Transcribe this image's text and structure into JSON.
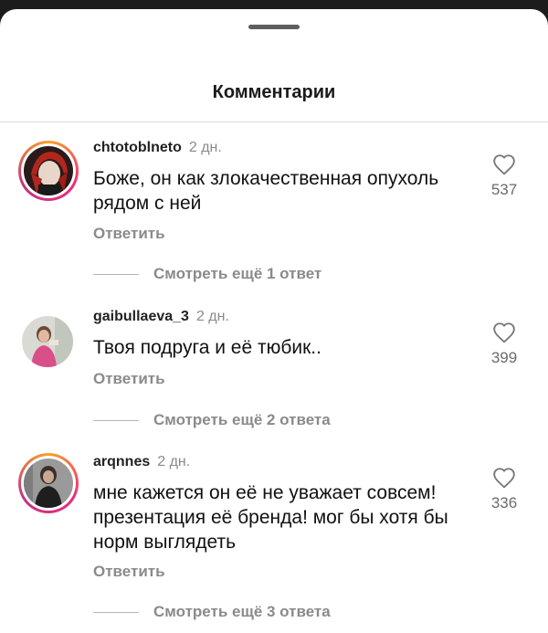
{
  "header": {
    "title": "Комментарии"
  },
  "comments": [
    {
      "username": "chtotoblneto",
      "time": "2 дн.",
      "text": "Боже, он как злокачественная опухоль рядом с ней",
      "reply_label": "Ответить",
      "likes": "537",
      "view_replies": "Смотреть ещё 1 ответ",
      "avatar_story_ring": true
    },
    {
      "username": "gaibullaeva_3",
      "time": "2 дн.",
      "text": "Твоя подруга и её тюбик..",
      "reply_label": "Ответить",
      "likes": "399",
      "view_replies": "Смотреть ещё 2 ответа",
      "avatar_story_ring": false
    },
    {
      "username": "arqnnes",
      "time": "2 дн.",
      "text": "мне кажется он её не уважает совсем! презентация её бренда! мог бы хотя бы норм выглядеть",
      "reply_label": "Ответить",
      "likes": "336",
      "view_replies": "Смотреть ещё 3 ответа",
      "avatar_story_ring": true
    }
  ],
  "colors": {
    "background_top": "#1c1c1c",
    "sheet": "#ffffff",
    "secondary_text": "#8a8a8a",
    "story_ring": [
      "#f9a227",
      "#ee2a7b",
      "#c13584"
    ]
  },
  "icons": {
    "like": "heart-outline-icon",
    "drag_handle": "sheet-handle"
  }
}
